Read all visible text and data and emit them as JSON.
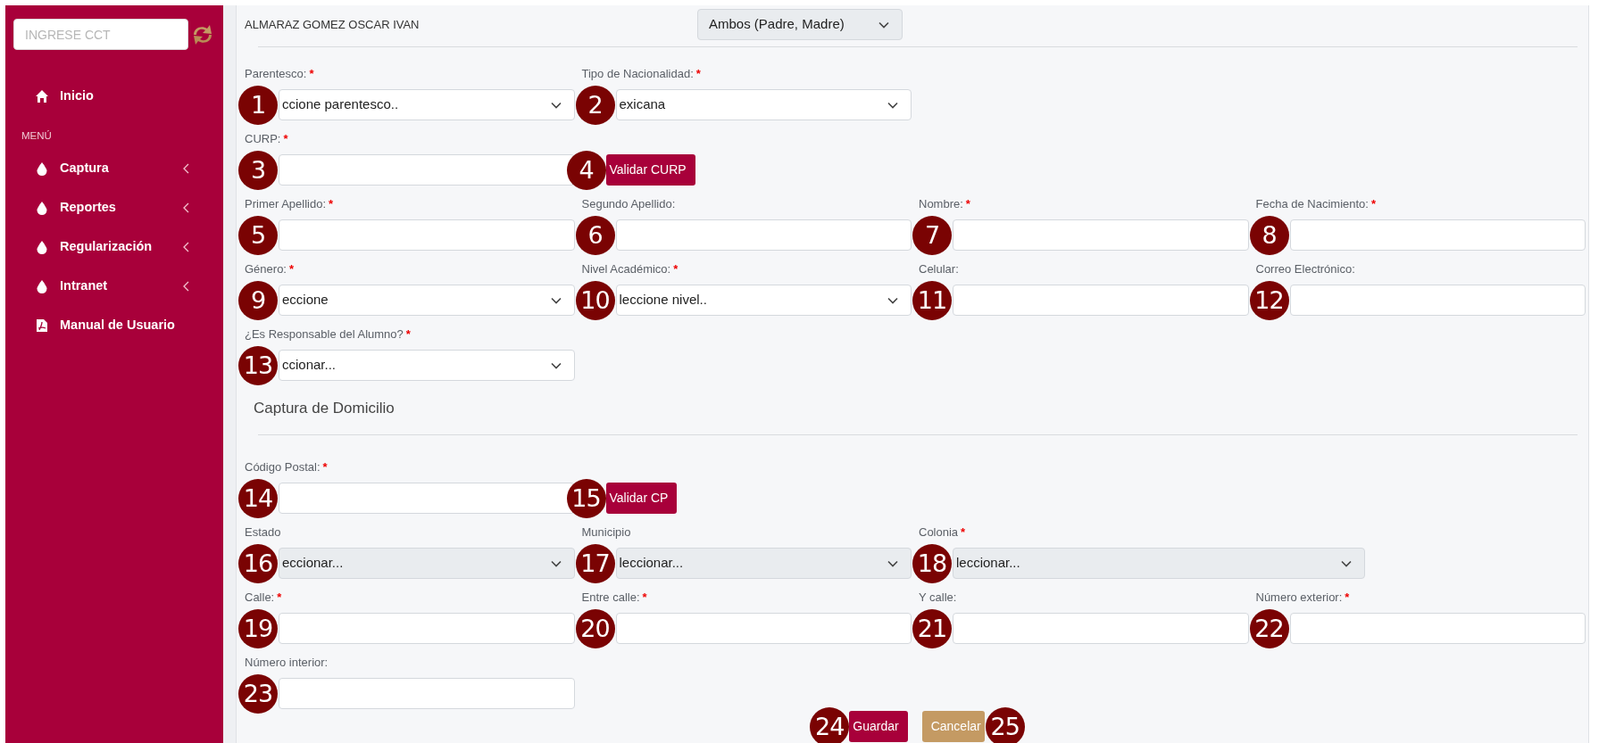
{
  "sidebar": {
    "search": {
      "placeholder": "INGRESE CCT"
    },
    "items": [
      {
        "kind": "link",
        "label": "Inicio"
      },
      {
        "kind": "heading",
        "label": "MENÚ"
      },
      {
        "kind": "submenu",
        "label": "Captura",
        "expanded": false
      },
      {
        "kind": "submenu",
        "label": "Reportes",
        "expanded": false
      },
      {
        "kind": "submenu",
        "label": "Regularización",
        "expanded": false
      },
      {
        "kind": "submenu",
        "label": "Intranet",
        "expanded": false
      },
      {
        "kind": "link",
        "label": "Manual de Usuario"
      }
    ]
  },
  "header": {
    "name": "ALMARAZ GOMEZ OSCAR IVAN",
    "relation": {
      "value": "Ambos (Padre, Madre)",
      "disabled": true
    }
  },
  "rows": [
    {
      "kind": "fields",
      "fields": [
        {
          "kind": "select",
          "label": "Parentesco:",
          "asterisk": "*",
          "value": "ccione parentesco..",
          "disabled": false,
          "marker": "1"
        },
        {
          "kind": "select",
          "label": "Tipo de Nacionalidad:",
          "asterisk": "*",
          "value": "exicana",
          "disabled": false,
          "marker": "2"
        }
      ]
    },
    {
      "kind": "fields",
      "fields": [
        {
          "kind": "input",
          "label": "CURP:",
          "asterisk": "*",
          "marker": "3"
        },
        {
          "kind": "button",
          "label": "Validar CURP",
          "marker": "4"
        }
      ]
    },
    {
      "kind": "fields",
      "fields": [
        {
          "kind": "input",
          "label": "Primer Apellido:",
          "asterisk": "*",
          "marker": "5"
        },
        {
          "kind": "input",
          "label": "Segundo Apellido:",
          "marker": "6"
        },
        {
          "kind": "input",
          "label": "Nombre:",
          "asterisk": "*",
          "marker": "7"
        },
        {
          "kind": "input",
          "label": "Fecha de Nacimiento:",
          "asterisk": "*",
          "marker": "8"
        }
      ]
    },
    {
      "kind": "fields",
      "fields": [
        {
          "kind": "select",
          "label": "Género:",
          "asterisk": "*",
          "value": "eccione",
          "disabled": false,
          "marker": "9"
        },
        {
          "kind": "select",
          "label": "Nivel Académico:",
          "asterisk": "*",
          "value": "leccione nivel..",
          "disabled": false,
          "marker": "10"
        },
        {
          "kind": "input",
          "label": "Celular:",
          "marker": "11"
        },
        {
          "kind": "input",
          "label": "Correo Electrónico:",
          "marker": "12"
        }
      ]
    },
    {
      "kind": "fields",
      "fields": [
        {
          "kind": "select",
          "label": "¿Es Responsable del Alumno?",
          "asterisk": "*",
          "value": "ccionar...",
          "disabled": false,
          "marker": "13"
        }
      ]
    },
    {
      "kind": "heading",
      "title": "Captura de Domicilio"
    },
    {
      "kind": "fields",
      "fields": [
        {
          "kind": "input",
          "label": "Código Postal:",
          "asterisk": "*",
          "marker": "14"
        },
        {
          "kind": "button",
          "label": "Validar CP",
          "marker": "15"
        }
      ]
    },
    {
      "kind": "fields",
      "fields": [
        {
          "kind": "select",
          "label": "Estado",
          "value": "eccionar...",
          "disabled": true,
          "marker": "16"
        },
        {
          "kind": "select",
          "label": "Municipio",
          "value": "leccionar...",
          "disabled": true,
          "marker": "17"
        },
        {
          "kind": "select",
          "label": "Colonia",
          "asterisk": "*",
          "value": "leccionar...",
          "disabled": true,
          "wide": true,
          "marker": "18"
        }
      ]
    },
    {
      "kind": "fields",
      "fields": [
        {
          "kind": "input",
          "label": "Calle:",
          "asterisk": "*",
          "marker": "19"
        },
        {
          "kind": "input",
          "label": "Entre calle:",
          "asterisk": "*",
          "marker": "20"
        },
        {
          "kind": "input",
          "label": "Y calle:",
          "marker": "21"
        },
        {
          "kind": "input",
          "label": "Número exterior:",
          "asterisk": "*",
          "marker": "22"
        }
      ]
    },
    {
      "kind": "fields",
      "fields": [
        {
          "kind": "input",
          "label": "Número interior:",
          "marker": "23"
        }
      ]
    }
  ],
  "actions": [
    {
      "label": "Guardar",
      "marker": "24"
    },
    {
      "label": "Cancelar",
      "marker": "25"
    }
  ]
}
